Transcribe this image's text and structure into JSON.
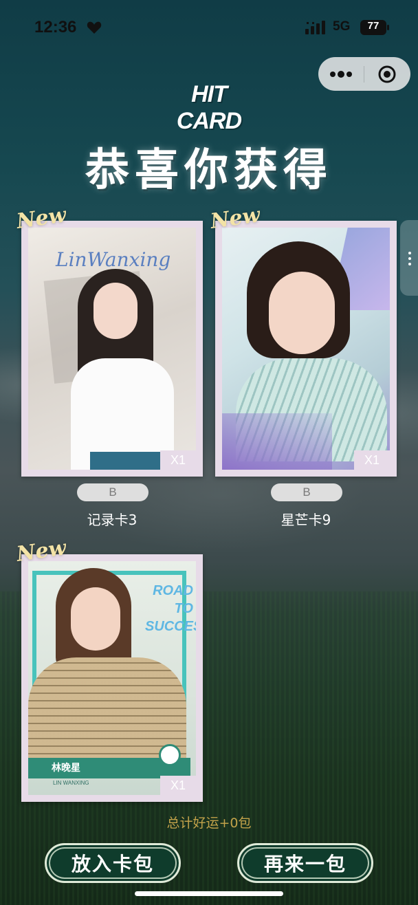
{
  "status_bar": {
    "time": "12:36",
    "network": "5G",
    "battery": "77"
  },
  "capsule": {
    "more_icon": "more-dots-icon",
    "close_icon": "target-close-icon"
  },
  "logo": {
    "text": "HIT CARD"
  },
  "headline": "恭喜你获得",
  "new_badge": "New",
  "cards": [
    {
      "name": "记录卡3",
      "rarity": "B",
      "quantity": "X1",
      "art_text": "LinWanxing",
      "theme": [
        "#e9e4de",
        "#b8b2aa"
      ]
    },
    {
      "name": "星芒卡9",
      "rarity": "B",
      "quantity": "X1",
      "art_text": "",
      "theme": [
        "#cfe4ea",
        "#8e8ac9"
      ]
    },
    {
      "name": "",
      "rarity": "",
      "quantity": "X1",
      "art_text": "ROAD TO SUCCESS",
      "caption_cn": "林晚星",
      "caption_en": "LIN WANXING",
      "theme": [
        "#dde7df",
        "#3cb8b2"
      ]
    }
  ],
  "luck_text": "总计好运+0包",
  "buttons": {
    "add_to_pack": "放入卡包",
    "another_pack": "再来一包"
  },
  "colors": {
    "button_bg": "#0f3c2c",
    "luck_text": "#c2a24a",
    "card_frame": "#e7dbe8"
  }
}
